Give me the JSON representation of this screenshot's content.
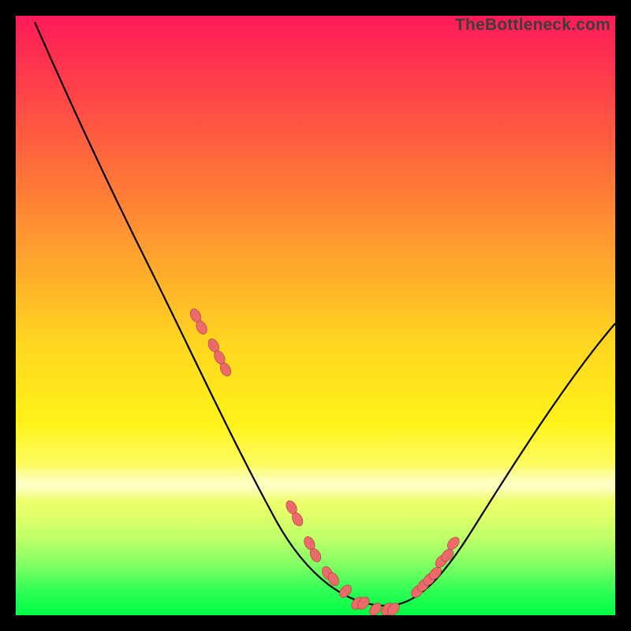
{
  "watermark": "TheBottleneck.com",
  "colors": {
    "frame_bg": "#000000",
    "curve_stroke": "#000000",
    "marker_fill": "#ec6a6a",
    "marker_stroke": "#a83b3b"
  },
  "chart_data": {
    "type": "line",
    "title": "",
    "xlabel": "",
    "ylabel": "",
    "xlim": [
      0,
      100
    ],
    "ylim": [
      0,
      100
    ],
    "x": [
      3,
      7,
      12,
      18,
      24,
      30,
      36,
      42,
      47,
      51,
      55,
      58,
      62,
      66,
      70,
      75,
      80,
      86,
      92,
      98,
      100
    ],
    "values": [
      100,
      93,
      84,
      73,
      62,
      51,
      40,
      29,
      19,
      11,
      5,
      2,
      1,
      2,
      6,
      12,
      20,
      29,
      38,
      46,
      49
    ],
    "markers": {
      "x": [
        30,
        31,
        33,
        34,
        35,
        46,
        47,
        49,
        50,
        52,
        53,
        55,
        57,
        58,
        60,
        62,
        63,
        67,
        68,
        69,
        70,
        71,
        72,
        73
      ],
      "y": [
        50,
        48,
        45,
        43,
        41,
        18,
        16,
        12,
        10,
        7,
        6,
        4,
        2,
        2,
        1,
        1,
        1,
        4,
        5,
        6,
        7,
        9,
        10,
        12
      ]
    }
  }
}
